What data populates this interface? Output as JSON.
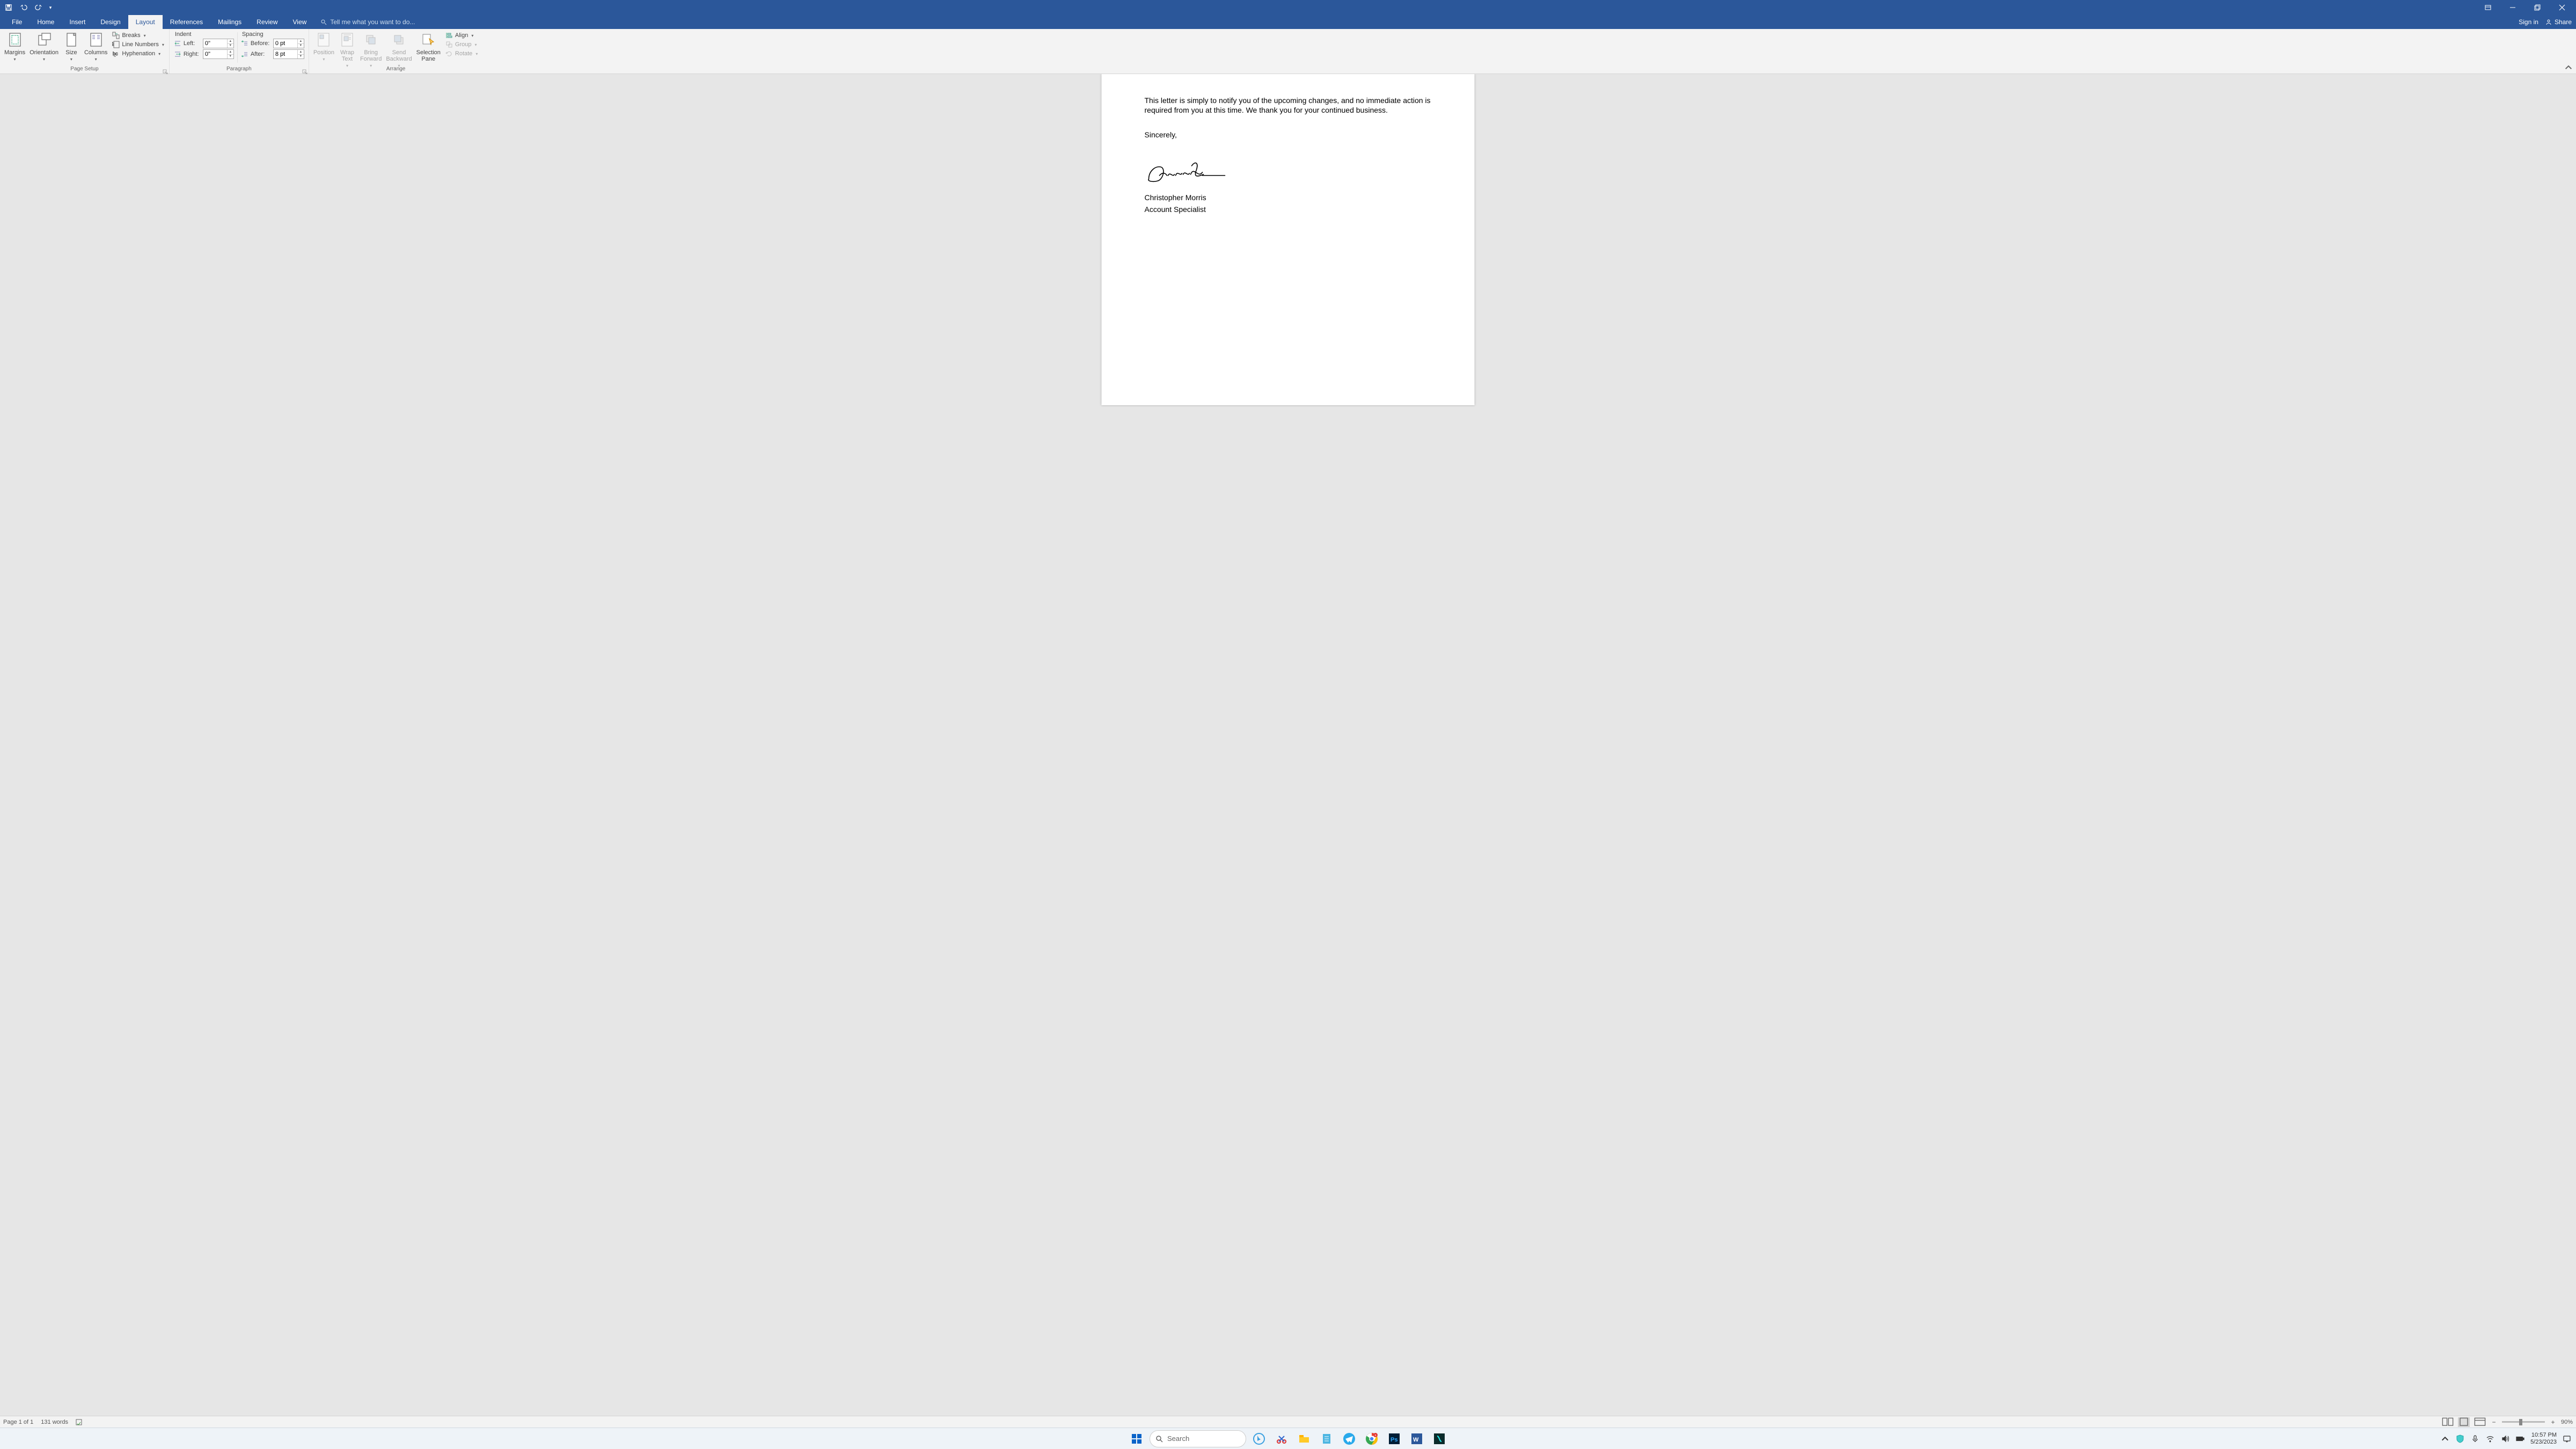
{
  "qat": {
    "save": "Save",
    "undo": "Undo",
    "redo": "Redo"
  },
  "window": {
    "sim": "Display Options",
    "min": "Minimize",
    "max": "Restore",
    "close": "Close"
  },
  "tabs": {
    "file": "File",
    "home": "Home",
    "insert": "Insert",
    "design": "Design",
    "layout": "Layout",
    "references": "References",
    "mailings": "Mailings",
    "review": "Review",
    "view": "View"
  },
  "tellme": "Tell me what you want to do...",
  "signin": "Sign in",
  "share": "Share",
  "ribbon": {
    "page_setup": {
      "label": "Page Setup",
      "margins": "Margins",
      "orientation": "Orientation",
      "size": "Size",
      "columns": "Columns",
      "breaks": "Breaks",
      "line_numbers": "Line Numbers",
      "hyphenation": "Hyphenation"
    },
    "paragraph": {
      "label": "Paragraph",
      "indent_header": "Indent",
      "spacing_header": "Spacing",
      "left_label": "Left:",
      "right_label": "Right:",
      "before_label": "Before:",
      "after_label": "After:",
      "left_val": "0\"",
      "right_val": "0\"",
      "before_val": "0 pt",
      "after_val": "8 pt"
    },
    "arrange": {
      "label": "Arrange",
      "position": "Position",
      "wrap": "Wrap\nText",
      "bring": "Bring\nForward",
      "send": "Send\nBackward",
      "selection": "Selection\nPane",
      "align": "Align",
      "group": "Group",
      "rotate": "Rotate"
    }
  },
  "document": {
    "para1": "This letter is simply to notify you of the upcoming changes, and no immediate action is required from you at this time. We thank you for your continued business.",
    "sincerely": "Sincerely,",
    "name": "Christopher Morris",
    "title": "Account Specialist"
  },
  "status": {
    "page": "Page 1 of 1",
    "words": "131 words",
    "zoom": "90%"
  },
  "taskbar": {
    "search": "Search",
    "time": "10:57 PM",
    "date": "5/23/2023"
  }
}
